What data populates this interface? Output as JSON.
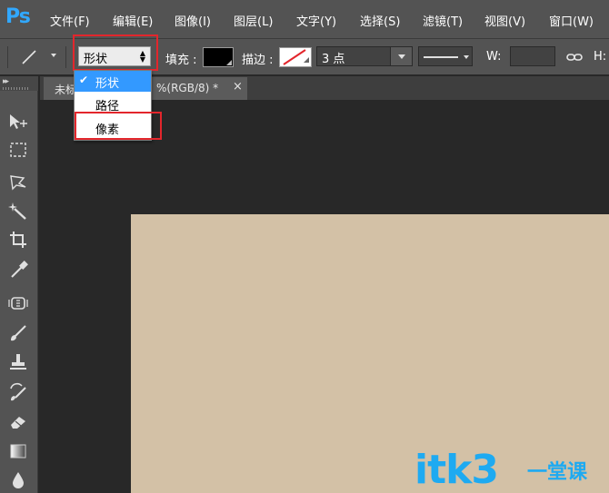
{
  "app": {
    "logo": "Ps"
  },
  "menu": {
    "items": [
      "文件(F)",
      "编辑(E)",
      "图像(I)",
      "图层(L)",
      "文字(Y)",
      "选择(S)",
      "滤镜(T)",
      "视图(V)",
      "窗口(W)"
    ]
  },
  "options_bar": {
    "tool_mode": "形状",
    "fill_label": "填充 :",
    "fill_color": "#000000",
    "stroke_label": "描边 :",
    "stroke_size": "3 点",
    "width_label": "W:",
    "height_label": "H:"
  },
  "tool_mode_dropdown": {
    "items": [
      "形状",
      "路径",
      "像素"
    ],
    "selected": "形状",
    "check": "✔"
  },
  "document_tab": {
    "prefix": "未标",
    "suffix": "%(RGB/8) *",
    "close": "×"
  },
  "toolbar": {
    "collapse": "▸▸",
    "tools": [
      "move-tool",
      "marquee-tool",
      "lasso-tool",
      "magic-wand-tool",
      "crop-tool",
      "eyedropper-tool",
      "healing-brush-tool",
      "brush-tool",
      "clone-stamp-tool",
      "history-brush-tool",
      "eraser-tool",
      "gradient-tool",
      "blur-tool"
    ]
  },
  "canvas": {
    "color": "#d3c1a6"
  },
  "watermark": {
    "text": "itk3",
    "cn": "一堂课",
    "color": "#1eaaf1"
  },
  "colors": {
    "accent": "#31a8ff",
    "highlight_box": "#e3262c",
    "menu_selected": "#3399ff"
  }
}
